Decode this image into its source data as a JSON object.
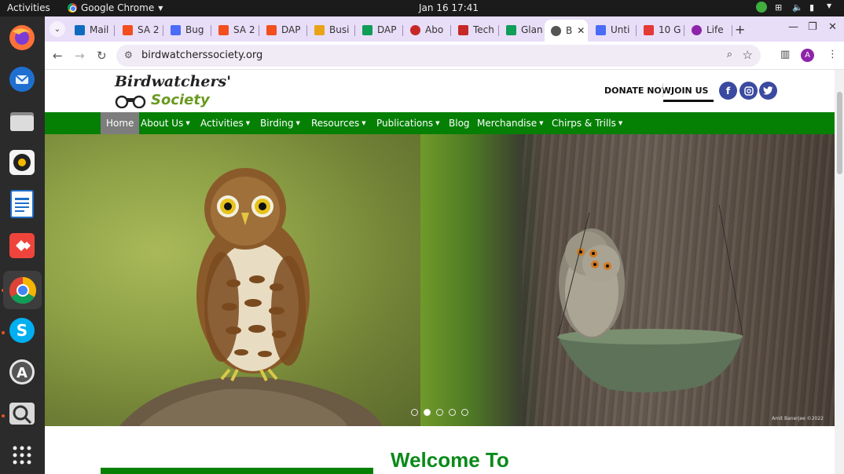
{
  "topbar": {
    "activities": "Activities",
    "app_name": "Google Chrome",
    "clock": "Jan 16  17:41"
  },
  "dock": {
    "apps": [
      "firefox-icon",
      "thunderbird-icon",
      "files-icon",
      "rhythmbox-icon",
      "writer-icon",
      "anydesk-icon",
      "chrome-icon",
      "skype-icon",
      "software-icon",
      "screenshot-icon",
      "app-grid-icon"
    ]
  },
  "tabs": [
    {
      "label": "Mail",
      "color": "#0f6cbd"
    },
    {
      "label": "SA 2",
      "color": "#f24e1e"
    },
    {
      "label": "Bug",
      "color": "#4a6cf7"
    },
    {
      "label": "SA 2",
      "color": "#f24e1e"
    },
    {
      "label": "DAP",
      "color": "#f24e1e"
    },
    {
      "label": "Busi",
      "color": "#e8a317"
    },
    {
      "label": "DAP",
      "color": "#0f9d58"
    },
    {
      "label": "Abo",
      "color": "#c62828"
    },
    {
      "label": "Tech",
      "color": "#c62828"
    },
    {
      "label": "Glan",
      "color": "#0f9d58"
    },
    {
      "label": "B",
      "color": "#555555"
    },
    {
      "label": "Unti",
      "color": "#4a6cf7"
    },
    {
      "label": "10 G",
      "color": "#e53935"
    },
    {
      "label": "Life",
      "color": "#8e24aa"
    }
  ],
  "toolbar": {
    "url": "birdwatcherssociety.org",
    "profile_initial": "A"
  },
  "site": {
    "logo_line1": "Birdwatchers'",
    "logo_line2": "Society",
    "donate": "DONATE NOW",
    "join": "JOIN US",
    "social": [
      "f",
      "ig",
      "tw"
    ],
    "nav": [
      {
        "label": "Home",
        "dropdown": false
      },
      {
        "label": "About Us",
        "dropdown": true
      },
      {
        "label": "Activities",
        "dropdown": true
      },
      {
        "label": "Birding",
        "dropdown": true
      },
      {
        "label": "Resources",
        "dropdown": true
      },
      {
        "label": "Publications",
        "dropdown": true
      },
      {
        "label": "Blog",
        "dropdown": false
      },
      {
        "label": "Merchandise",
        "dropdown": true
      },
      {
        "label": "Chirps & Trills",
        "dropdown": true
      }
    ],
    "carousel_slides": 5,
    "carousel_active": 2,
    "photo_credit": "Amit Banerjee ©2022",
    "welcome": "Welcome To"
  },
  "colors": {
    "nav_green": "#058005",
    "welcome_green": "#0a8a1a",
    "tabstrip": "#e8def8"
  }
}
